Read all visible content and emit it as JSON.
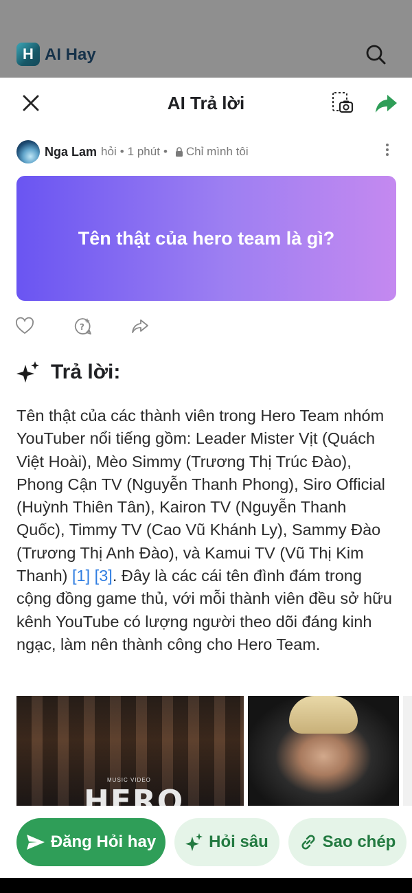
{
  "background_app": {
    "logo_letter": "H",
    "app_name": "AI Hay"
  },
  "sheet": {
    "title": "AI Trả lời",
    "author": {
      "name": "Nga Lam",
      "action": "hỏi",
      "time": "1 phút",
      "privacy": "Chỉ mình tôi"
    },
    "question": "Tên thật của hero team là gì?",
    "answer": {
      "heading": "Trả lời:",
      "text_before_citations": "Tên thật của các thành viên trong Hero Team nhóm YouTuber nổi tiếng gồm: Leader Mister Vịt (Quách Việt Hoài), Mèo Simmy (Trương Thị Trúc Đào), Phong Cận TV (Nguyễn Thanh Phong), Siro Official (Huỳnh Thiên Tân), Kairon TV (Nguyễn Thanh Quốc), Timmy TV (Cao Vũ Khánh Ly), Sammy Đào (Trương Thị Anh Đào), và Kamui TV (Vũ Thị Kim Thanh) ",
      "citation_1": "[1]",
      "citation_2": "[3]",
      "text_after_citations": ". Đây là các cái tên đình đám trong cộng đồng game thủ, với mỗi thành viên đều sở hữu kênh YouTube có lượng người theo dõi đáng kinh ngạc, làm nên thành công cho Hero Team."
    },
    "image_caption_small": "MUSIC VIDEO",
    "image_caption_big": "HERO"
  },
  "bottom_actions": {
    "post_label": "Đăng Hỏi hay",
    "deep_label": "Hỏi sâu",
    "copy_label": "Sao chép"
  },
  "colors": {
    "primary_green": "#2f9e58",
    "secondary_green_bg": "#e5f4e8",
    "citation_blue": "#2f7de1",
    "question_gradient_start": "#6a55f2",
    "question_gradient_end": "#c489f0"
  },
  "icons": [
    "close-icon",
    "screenshot-icon",
    "share-icon",
    "more-vertical-icon",
    "lock-icon",
    "heart-icon",
    "ask-icon",
    "forward-icon",
    "sparkle-icon",
    "send-icon",
    "link-icon",
    "search-icon"
  ]
}
